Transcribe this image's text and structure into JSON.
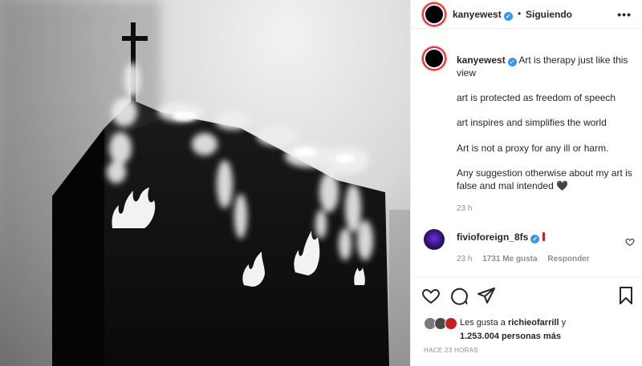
{
  "media": {
    "alt_icon": "church-on-fire-image"
  },
  "header": {
    "username": "kanyewest",
    "dot": "•",
    "follow_status": "Siguiendo",
    "more_icon": "more-horizontal-icon"
  },
  "caption": {
    "username": "kanyewest",
    "first_line": "Art is therapy just like this view",
    "lines": [
      "art is protected as freedom of speech",
      "art inspires and simplifies the world",
      "Art is not a proxy for any ill or harm.",
      "Any suggestion otherwise about my art is false and mal intended 🖤"
    ],
    "time": "23 h"
  },
  "comment": {
    "username": "fivioforeign_8fs",
    "time": "23 h",
    "likes": "1731 Me gusta",
    "reply": "Responder"
  },
  "likes": {
    "prefix": "Les gusta a ",
    "user": "richieofarrill",
    "mid": " y",
    "count": "1.253.004 personas más"
  },
  "posted": "HACE 23 HORAS",
  "colors": {
    "verified": "#3897f0",
    "secondary_text": "#8e8e8e",
    "border": "#efefef"
  }
}
